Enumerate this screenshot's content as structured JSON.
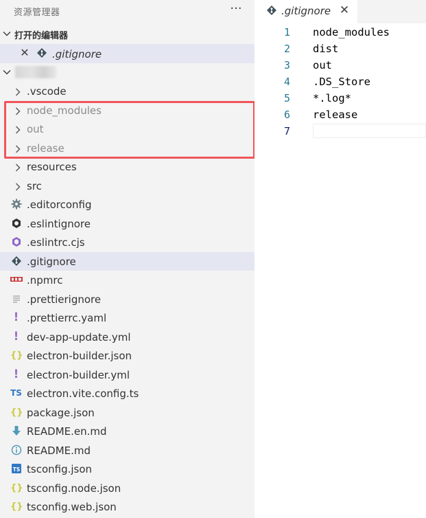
{
  "explorer": {
    "title": "资源管理器",
    "more_label": "···",
    "open_editors": {
      "label": "打开的编辑器",
      "items": [
        {
          "name": ".gitignore",
          "icon": "git-icon"
        }
      ]
    },
    "workspace": {
      "name_hidden": true
    },
    "tree": [
      {
        "name": ".vscode",
        "type": "folder",
        "icon": "chevron-right-icon"
      },
      {
        "name": "node_modules",
        "type": "folder",
        "icon": "chevron-right-icon",
        "dimmed": true
      },
      {
        "name": "out",
        "type": "folder",
        "icon": "chevron-right-icon",
        "dimmed": true
      },
      {
        "name": "release",
        "type": "folder",
        "icon": "chevron-right-icon",
        "dimmed": true
      },
      {
        "name": "resources",
        "type": "folder",
        "icon": "chevron-right-icon"
      },
      {
        "name": "src",
        "type": "folder",
        "icon": "chevron-right-icon"
      },
      {
        "name": ".editorconfig",
        "type": "file",
        "icon": "gear-icon"
      },
      {
        "name": ".eslintignore",
        "type": "file",
        "icon": "eslint-icon"
      },
      {
        "name": ".eslintrc.cjs",
        "type": "file",
        "icon": "eslint-config-icon"
      },
      {
        "name": ".gitignore",
        "type": "file",
        "icon": "git-icon",
        "selected": true
      },
      {
        "name": ".npmrc",
        "type": "file",
        "icon": "npm-icon"
      },
      {
        "name": ".prettierignore",
        "type": "file",
        "icon": "lines-icon"
      },
      {
        "name": ".prettierrc.yaml",
        "type": "file",
        "icon": "yaml-icon"
      },
      {
        "name": "dev-app-update.yml",
        "type": "file",
        "icon": "yaml-icon"
      },
      {
        "name": "electron-builder.json",
        "type": "file",
        "icon": "json-icon"
      },
      {
        "name": "electron-builder.yml",
        "type": "file",
        "icon": "yaml-icon"
      },
      {
        "name": "electron.vite.config.ts",
        "type": "file",
        "icon": "typescript-icon"
      },
      {
        "name": "package.json",
        "type": "file",
        "icon": "json-icon"
      },
      {
        "name": "README.en.md",
        "type": "file",
        "icon": "markdown-download-icon"
      },
      {
        "name": "README.md",
        "type": "file",
        "icon": "info-icon"
      },
      {
        "name": "tsconfig.json",
        "type": "file",
        "icon": "tsconfig-icon"
      },
      {
        "name": "tsconfig.node.json",
        "type": "file",
        "icon": "json-icon"
      },
      {
        "name": "tsconfig.web.json",
        "type": "file",
        "icon": "json-icon"
      }
    ],
    "glyphs": {
      "json-icon": "{}",
      "yaml-icon": "!",
      "typescript-icon": "TS",
      "npm-icon": "npm"
    }
  },
  "editor": {
    "tab": {
      "label": ".gitignore",
      "close_label": "✕"
    },
    "lines": [
      {
        "num": "1",
        "text": "node_modules"
      },
      {
        "num": "2",
        "text": "dist"
      },
      {
        "num": "3",
        "text": "out"
      },
      {
        "num": "4",
        "text": ".DS_Store"
      },
      {
        "num": "5",
        "text": "*.log*"
      },
      {
        "num": "6",
        "text": "release"
      },
      {
        "num": "7",
        "text": "",
        "current": true
      }
    ]
  },
  "colors": {
    "json": "#cbcb41",
    "yaml": "#a074c4",
    "typescript": "#3178c6",
    "git": "#41535b",
    "npm": "#cb3837",
    "markdown": "#519aba",
    "highlight": "#f0555a"
  }
}
